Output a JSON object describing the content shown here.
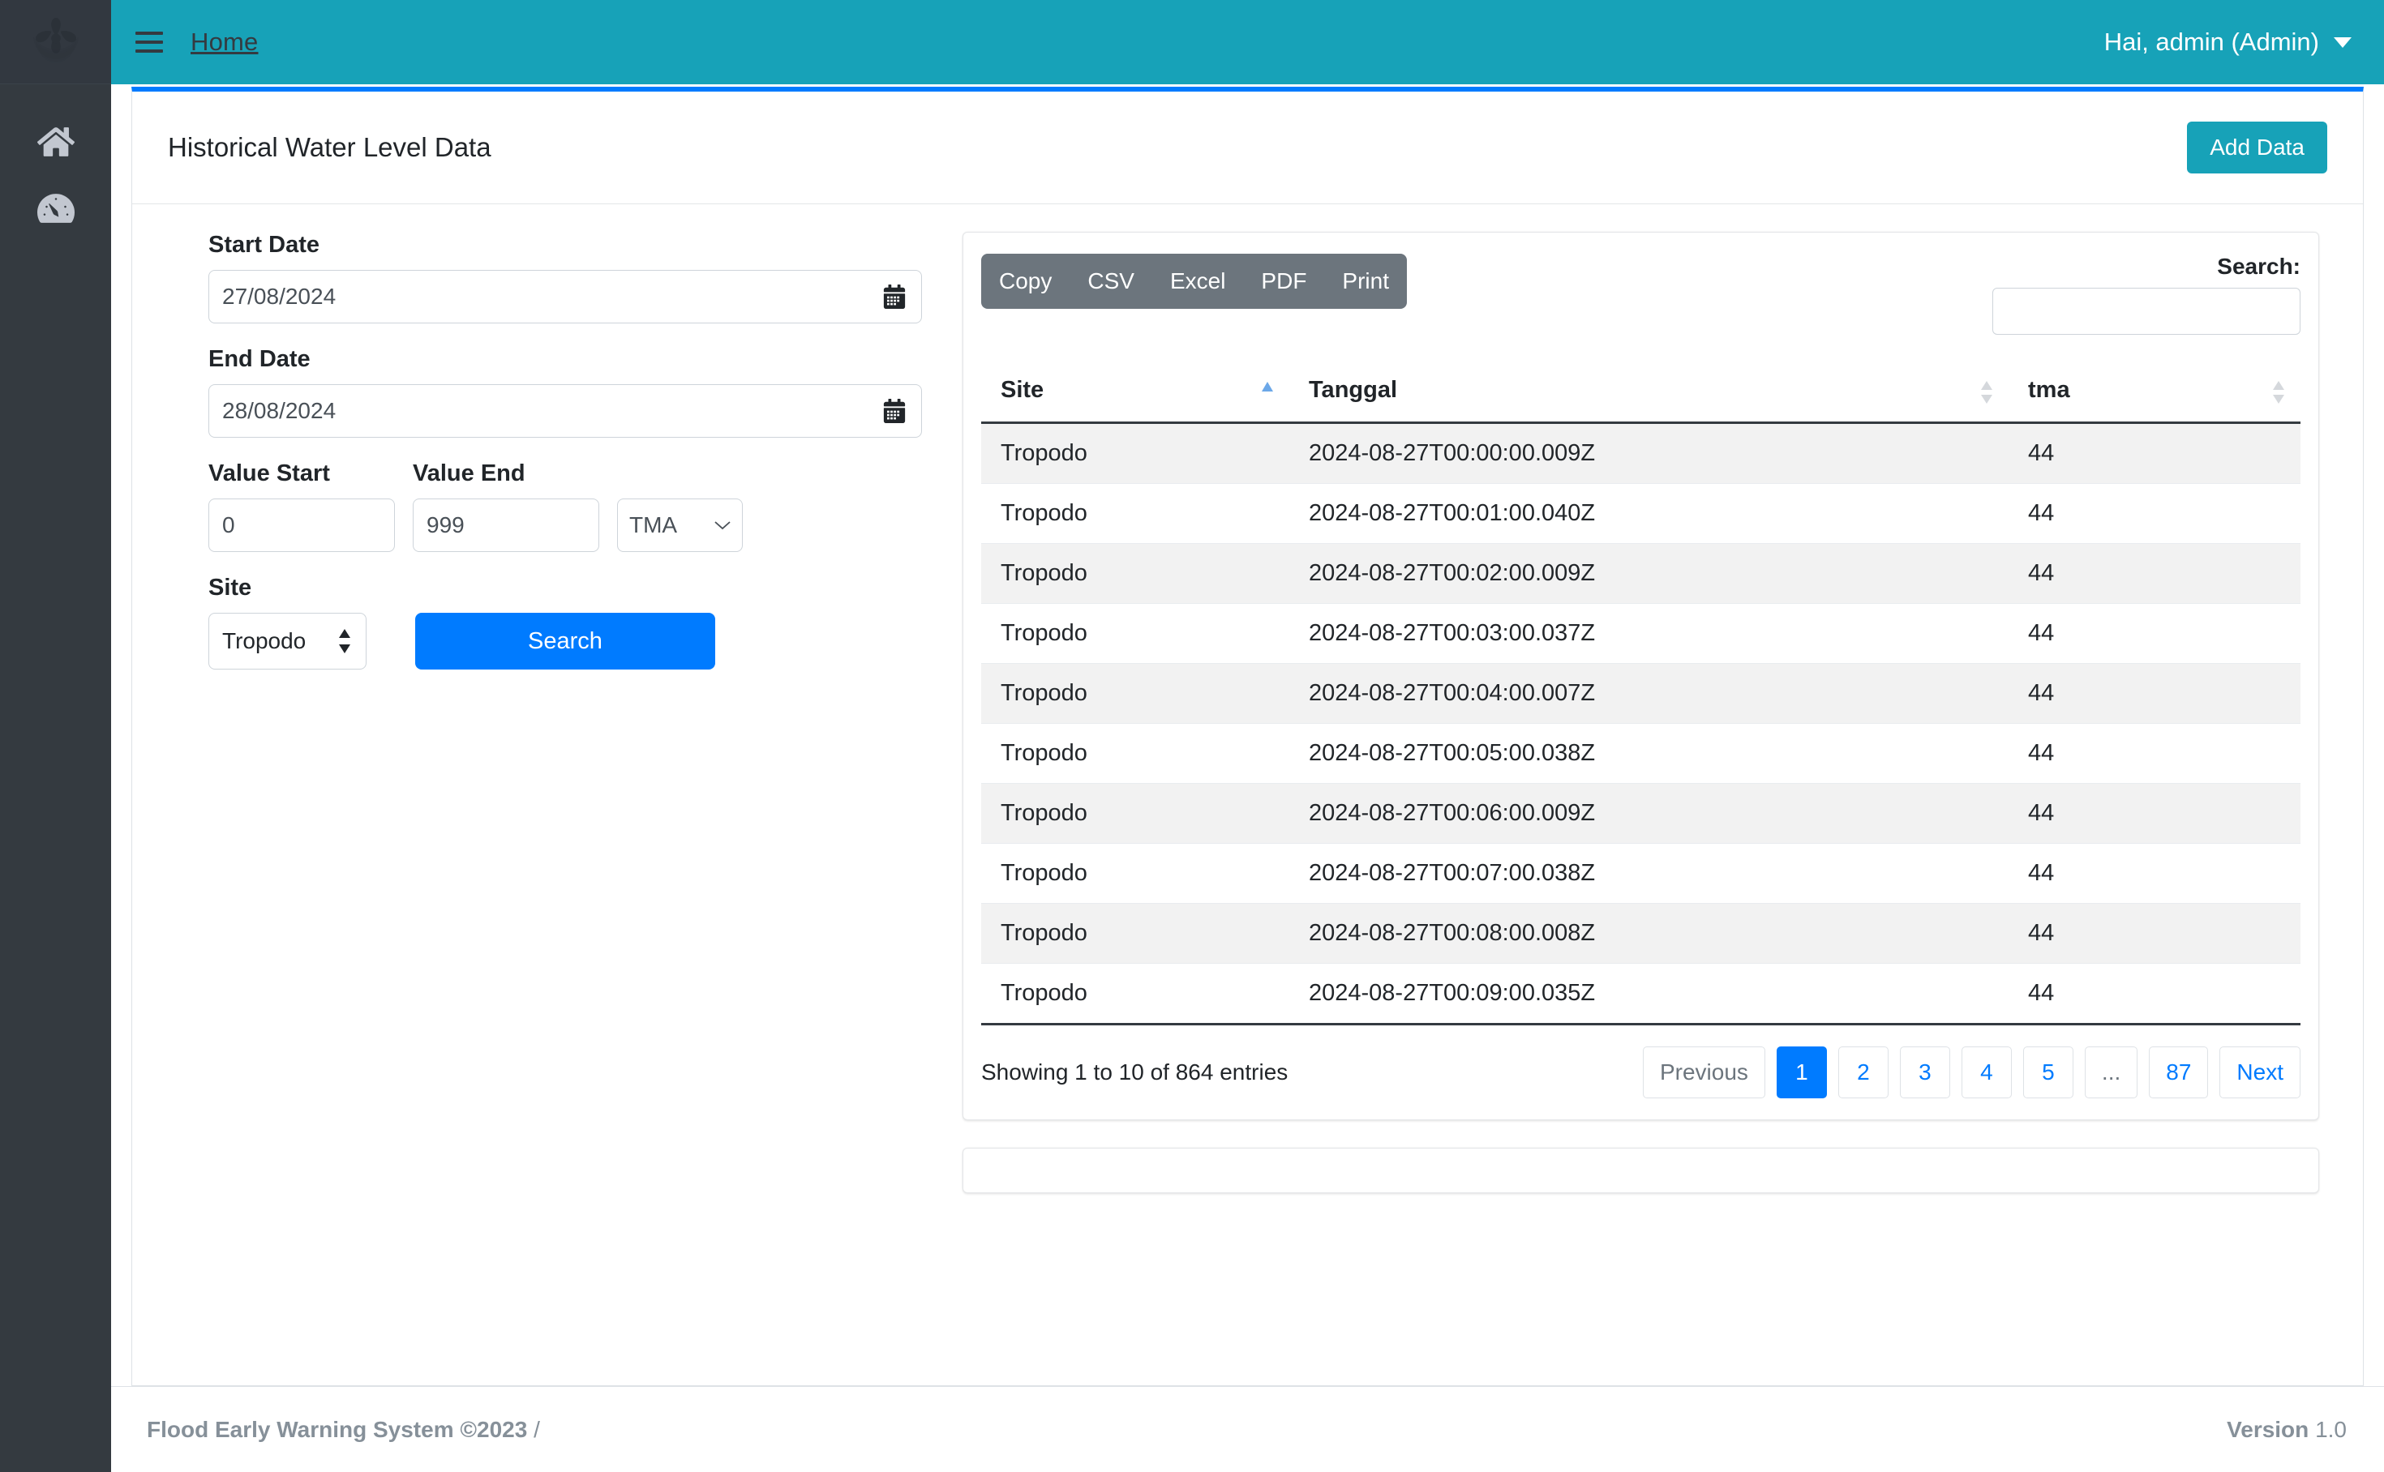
{
  "brand": {
    "logo_icon": "propeller-logo-icon"
  },
  "sidebar": {
    "items": [
      {
        "icon": "home-icon",
        "name": "home"
      },
      {
        "icon": "tachometer-icon",
        "name": "dashboard"
      }
    ]
  },
  "topbar": {
    "menu_icon": "hamburger-menu-icon",
    "home_link": "Home",
    "user_label": "Hai, admin (Admin)",
    "caret_icon": "chevron-down-icon",
    "bg_color": "#17a2b8"
  },
  "page": {
    "title": "Historical Water Level Data",
    "add_button": "Add Data",
    "accent_top_border": "#007bff"
  },
  "filters": {
    "start_date_label": "Start Date",
    "start_date_value": "27/08/2024",
    "end_date_label": "End Date",
    "end_date_value": "28/08/2024",
    "value_start_label": "Value Start",
    "value_start_value": "0",
    "value_end_label": "Value End",
    "value_end_value": "999",
    "measure_selected": "TMA",
    "site_label": "Site",
    "site_selected": "Tropodo",
    "search_button": "Search",
    "calendar_icon": "calendar-icon"
  },
  "datatable": {
    "export_buttons": [
      "Copy",
      "CSV",
      "Excel",
      "PDF",
      "Print"
    ],
    "search_label": "Search:",
    "search_value": "",
    "search_placeholder": "",
    "columns": [
      {
        "label": "Site",
        "sort": "asc"
      },
      {
        "label": "Tanggal",
        "sort": "none"
      },
      {
        "label": "tma",
        "sort": "none"
      }
    ],
    "rows": [
      {
        "site": "Tropodo",
        "tanggal": "2024-08-27T00:00:00.009Z",
        "tma": "44"
      },
      {
        "site": "Tropodo",
        "tanggal": "2024-08-27T00:01:00.040Z",
        "tma": "44"
      },
      {
        "site": "Tropodo",
        "tanggal": "2024-08-27T00:02:00.009Z",
        "tma": "44"
      },
      {
        "site": "Tropodo",
        "tanggal": "2024-08-27T00:03:00.037Z",
        "tma": "44"
      },
      {
        "site": "Tropodo",
        "tanggal": "2024-08-27T00:04:00.007Z",
        "tma": "44"
      },
      {
        "site": "Tropodo",
        "tanggal": "2024-08-27T00:05:00.038Z",
        "tma": "44"
      },
      {
        "site": "Tropodo",
        "tanggal": "2024-08-27T00:06:00.009Z",
        "tma": "44"
      },
      {
        "site": "Tropodo",
        "tanggal": "2024-08-27T00:07:00.038Z",
        "tma": "44"
      },
      {
        "site": "Tropodo",
        "tanggal": "2024-08-27T00:08:00.008Z",
        "tma": "44"
      },
      {
        "site": "Tropodo",
        "tanggal": "2024-08-27T00:09:00.035Z",
        "tma": "44"
      }
    ],
    "info": "Showing 1 to 10 of 864 entries",
    "pagination": {
      "previous": "Previous",
      "pages": [
        "1",
        "2",
        "3",
        "4",
        "5",
        "...",
        "87"
      ],
      "active": "1",
      "next": "Next"
    }
  },
  "footer": {
    "left_strong": "Flood Early Warning System ©2023",
    "left_rest": " /",
    "version_label": "Version",
    "version_value": "1.0"
  }
}
